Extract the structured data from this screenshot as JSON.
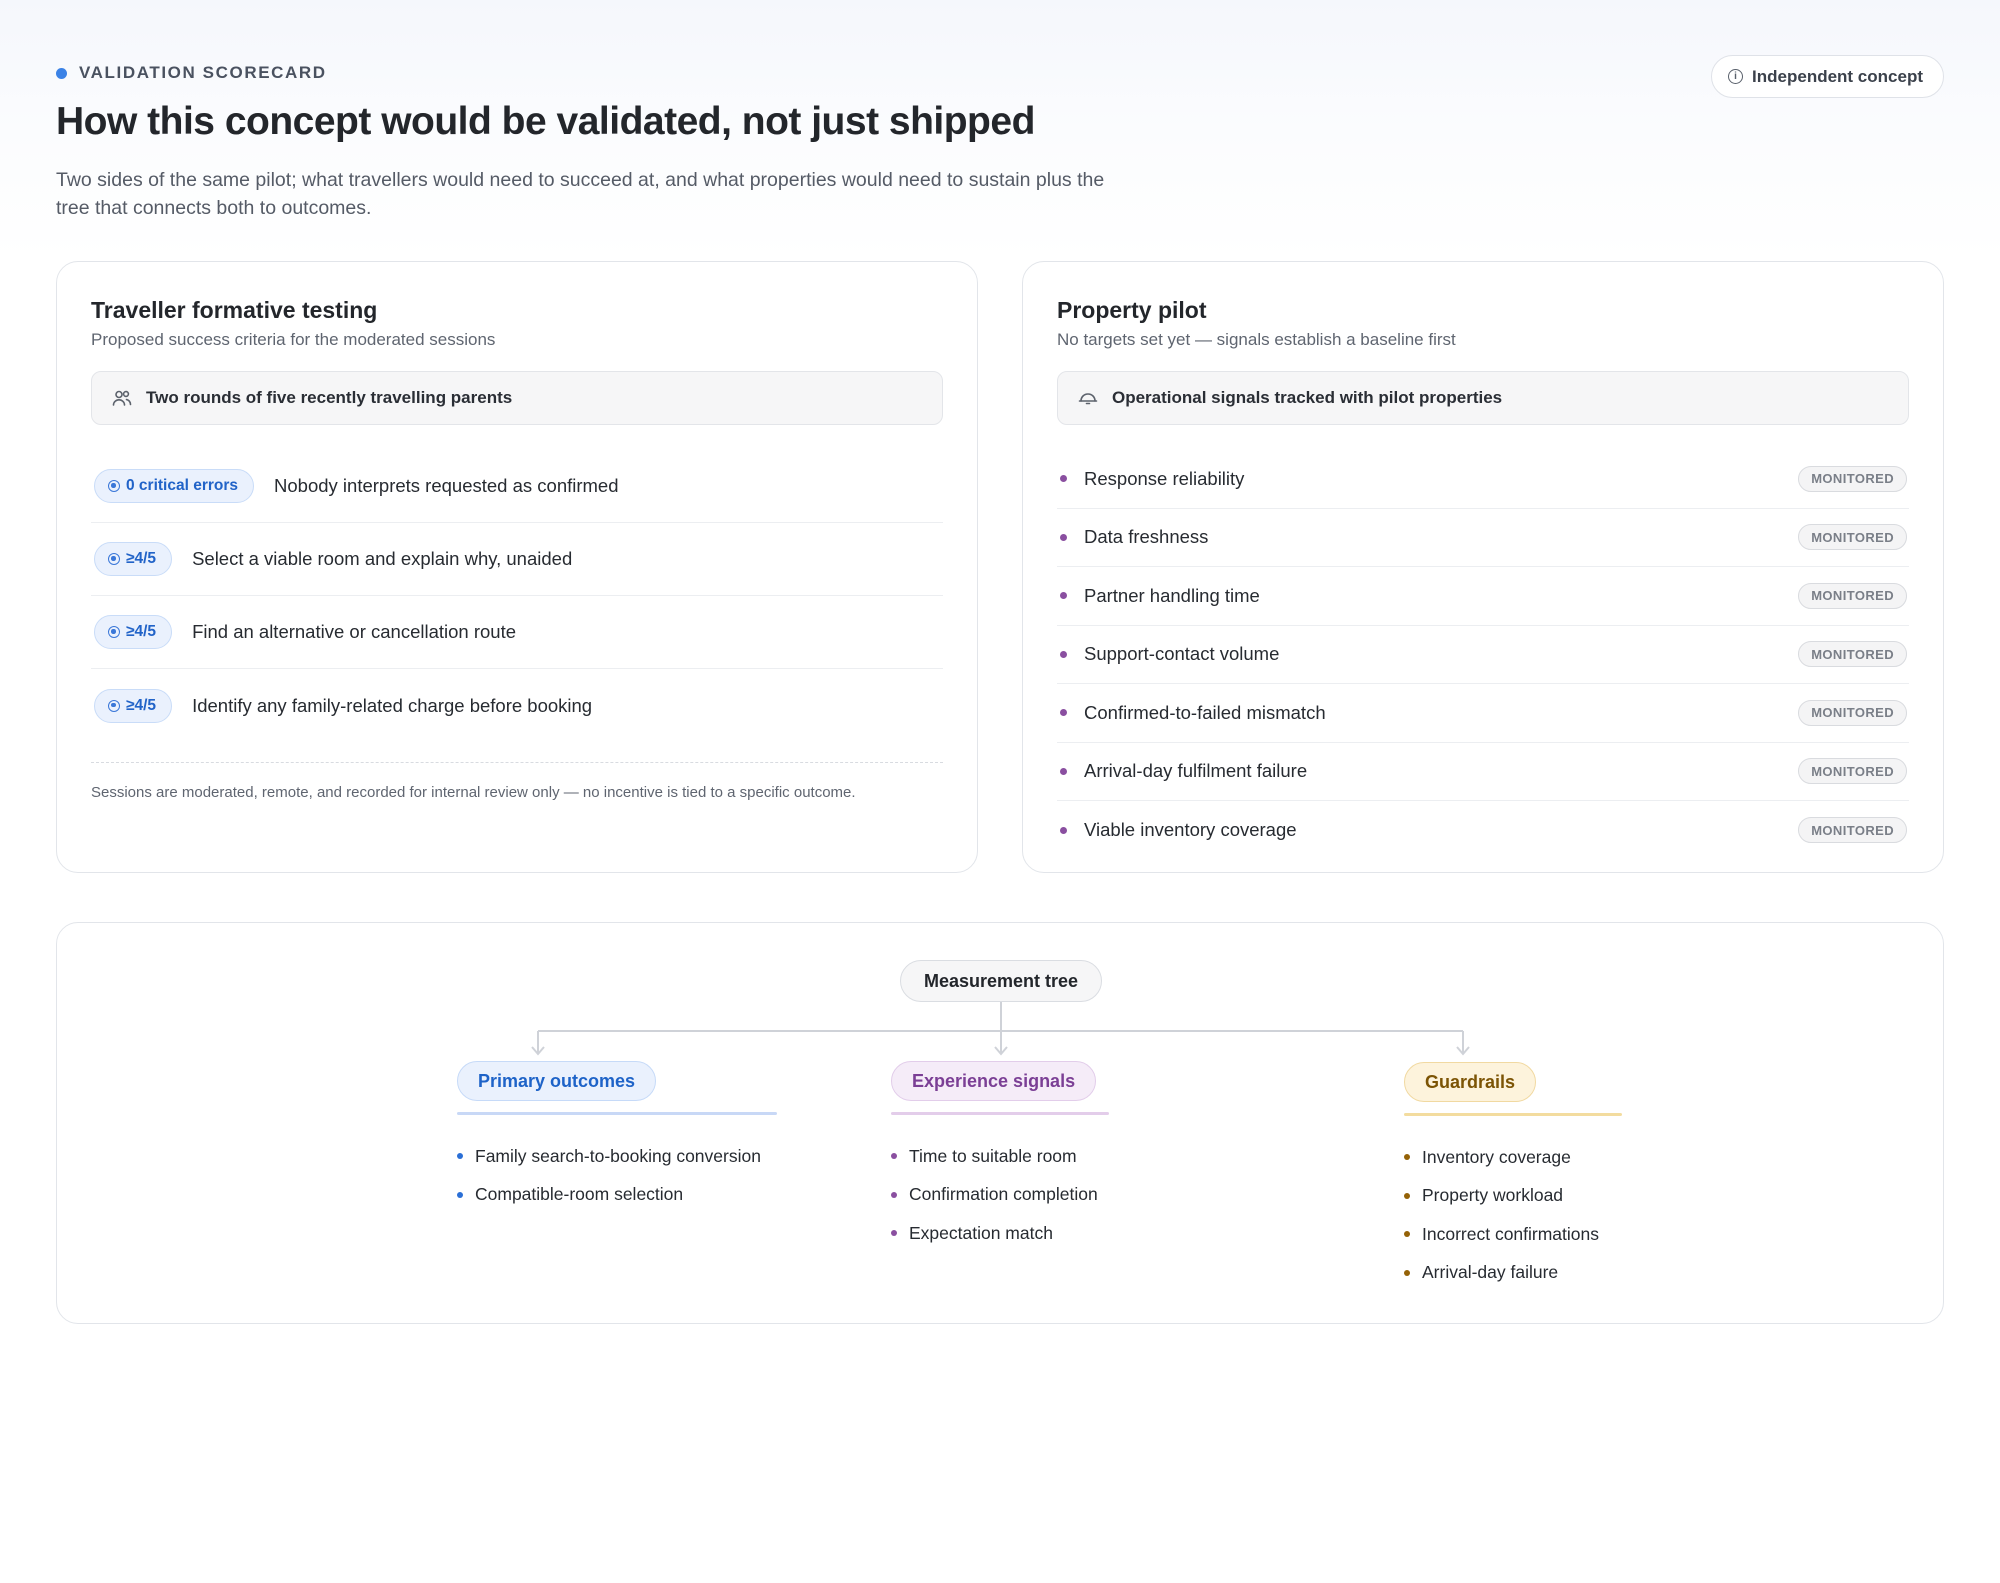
{
  "header": {
    "eyebrow": "VALIDATION SCORECARD",
    "title": "How this concept would be validated, not just shipped",
    "subtitle": "Two sides of the same pilot; what travellers would need to succeed at, and what properties would need to sustain plus the tree that connects both to outcomes.",
    "concept_pill": "Independent concept",
    "concept_icon": "info-icon",
    "accent_color": "#3b82e6"
  },
  "traveller": {
    "title": "Traveller formative testing",
    "subtitle": "Proposed success criteria for the moderated sessions",
    "callout": "Two rounds of five recently travelling parents",
    "callout_icon": "users-icon",
    "criteria": [
      {
        "target": "0 critical errors",
        "text": "Nobody interprets requested as confirmed"
      },
      {
        "target": "≥4/5",
        "text": "Select a viable room and explain why, unaided"
      },
      {
        "target": "≥4/5",
        "text": "Find an alternative or cancellation route"
      },
      {
        "target": "≥4/5",
        "text": "Identify any family-related charge before booking"
      }
    ],
    "footnote": "Sessions are moderated, remote, and recorded for internal review only — no incentive is tied to a specific outcome.",
    "badge_color": "#2163c8"
  },
  "property": {
    "title": "Property pilot",
    "subtitle": "No targets set yet — signals establish a baseline first",
    "callout": "Operational signals tracked with pilot properties",
    "callout_icon": "bell-icon",
    "signals": [
      {
        "label": "Response reliability",
        "status": "MONITORED"
      },
      {
        "label": "Data freshness",
        "status": "MONITORED"
      },
      {
        "label": "Partner handling time",
        "status": "MONITORED"
      },
      {
        "label": "Support-contact volume",
        "status": "MONITORED"
      },
      {
        "label": "Confirmed-to-failed mismatch",
        "status": "MONITORED"
      },
      {
        "label": "Arrival-day fulfilment failure",
        "status": "MONITORED"
      },
      {
        "label": "Viable inventory coverage",
        "status": "MONITORED"
      }
    ],
    "dot_color": "#8a4fa0"
  },
  "tree": {
    "root": "Measurement tree",
    "branches": [
      {
        "label": "Primary outcomes",
        "color": "#1e63c8",
        "items": [
          "Family search-to-booking conversion",
          "Compatible-room selection"
        ]
      },
      {
        "label": "Experience signals",
        "color": "#7b3f95",
        "items": [
          "Time to suitable room",
          "Confirmation completion",
          "Expectation match"
        ]
      },
      {
        "label": "Guardrails",
        "color": "#7c5405",
        "items": [
          "Inventory coverage",
          "Property workload",
          "Incorrect confirmations",
          "Arrival-day failure"
        ]
      }
    ]
  }
}
